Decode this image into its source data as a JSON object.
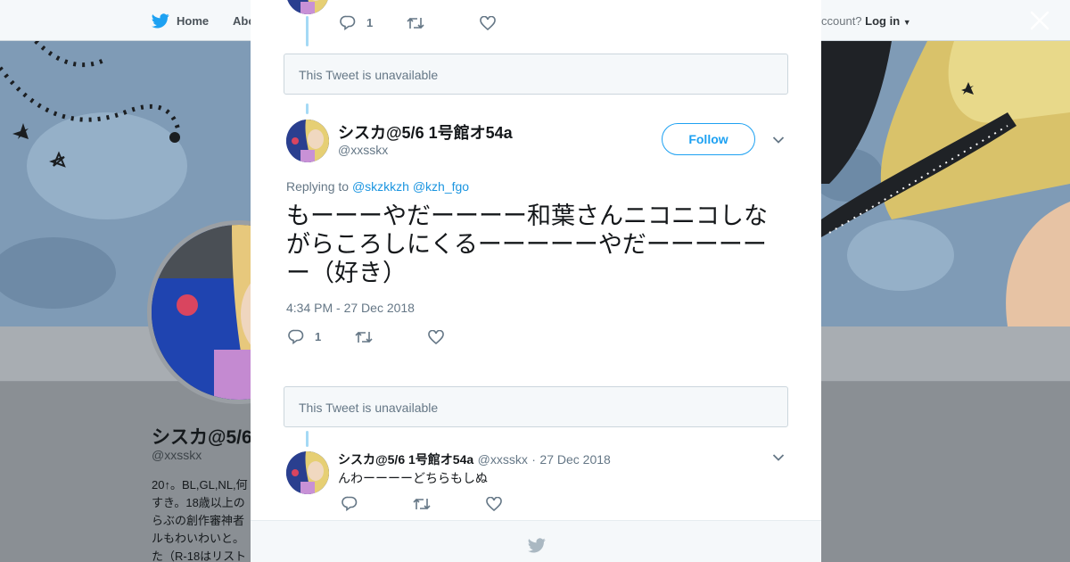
{
  "background_page": {
    "nav": {
      "home_label": "Home",
      "about_label": "Abo",
      "account_prompt": "ccount?",
      "login_label": "Log in"
    },
    "profile": {
      "name": "シスカ@5/6",
      "handle": "@xxsskx",
      "bio": "20↑。BL,GL,NL,何\nすき。18歳以上の\nらぶの創作審神者\nルもわいわいと。\nた（R-18はリスト"
    }
  },
  "modal": {
    "prev_tweet": {
      "reply_count": "1"
    },
    "unavailable_1": "This Tweet is unavailable",
    "main_tweet": {
      "display_name": "シスカ@5/6 1号館オ54a",
      "handle": "@xxsskx",
      "follow_label": "Follow",
      "replying_prefix": "Replying to",
      "replying_to_1": "@skzkkzh",
      "replying_to_2": "@kzh_fgo",
      "text": "もーーーやだーーーー和葉さんニコニコしながらころしにくるーーーーーやだーーーーーー（好き）",
      "timestamp": "4:34 PM - 27 Dec 2018",
      "reply_count": "1"
    },
    "unavailable_2": "This Tweet is unavailable",
    "reply_tweet": {
      "display_name": "シスカ@5/6 1号館オ54a",
      "handle": "@xxsskx",
      "separator": "·",
      "date": "27 Dec 2018",
      "text": "んわーーーーどちらもしぬ"
    }
  },
  "colors": {
    "twitter_blue": "#1da1f2",
    "thread_line": "#a4d9f5",
    "muted_text": "#657786"
  },
  "icons": [
    "twitter-bird-icon",
    "close-icon",
    "reply-icon",
    "retweet-icon",
    "like-icon",
    "chevron-down-icon"
  ]
}
